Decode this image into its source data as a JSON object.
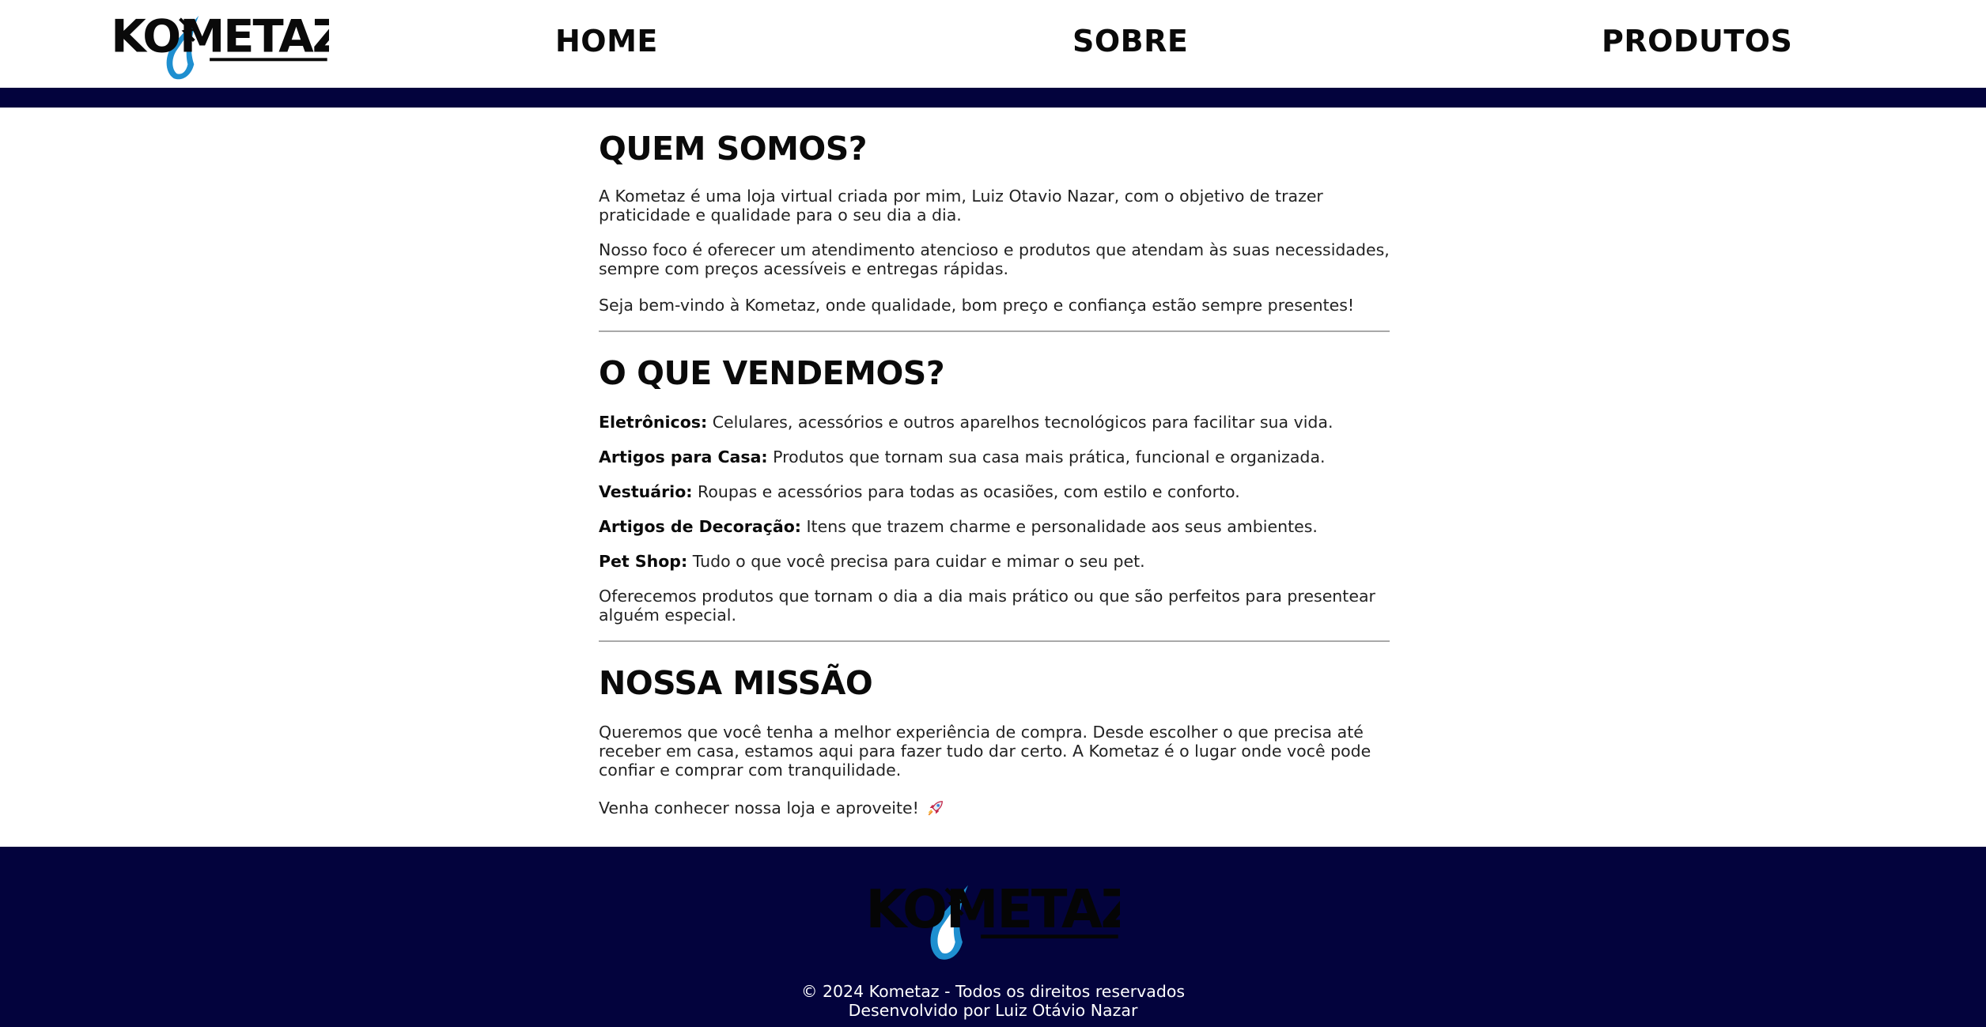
{
  "header": {
    "logo_text": "KOMETAZ",
    "nav": [
      {
        "label": "HOME"
      },
      {
        "label": "SOBRE"
      },
      {
        "label": "PRODUTOS"
      }
    ]
  },
  "about": {
    "title": "QUEM SOMOS?",
    "paragraphs": [
      "A Kometaz é uma loja virtual criada por mim, Luiz Otavio Nazar, com o objetivo de trazer praticidade e qualidade para o seu dia a dia.",
      "Nosso foco é oferecer um atendimento atencioso e produtos que atendam às suas necessidades, sempre com preços acessíveis e entregas rápidas.",
      "Seja bem-vindo à Kometaz, onde qualidade, bom preço e confiança estão sempre presentes!"
    ]
  },
  "sales": {
    "title": "O QUE VENDEMOS?",
    "items": [
      {
        "label": "Eletrônicos:",
        "text": " Celulares, acessórios e outros aparelhos tecnológicos para facilitar sua vida."
      },
      {
        "label": "Artigos para Casa:",
        "text": " Produtos que tornam sua casa mais prática, funcional e organizada."
      },
      {
        "label": "Vestuário:",
        "text": " Roupas e acessórios para todas as ocasiões, com estilo e conforto."
      },
      {
        "label": "Artigos de Decoração:",
        "text": " Itens que trazem charme e personalidade aos seus ambientes."
      },
      {
        "label": "Pet Shop:",
        "text": " Tudo o que você precisa para cuidar e mimar o seu pet."
      }
    ],
    "closing": "Oferecemos produtos que tornam o dia a dia mais prático ou que são perfeitos para presentear alguém especial."
  },
  "mission": {
    "title": "NOSSA MISSÃO",
    "paragraphs": [
      "Queremos que você tenha a melhor experiência de compra. Desde escolher o que precisa até receber em casa, estamos aqui para fazer tudo dar certo. A Kometaz é o lugar onde você pode confiar e comprar com tranquilidade.",
      "Venha conhecer nossa loja e aproveite!"
    ],
    "closing_icon": "rocket-icon"
  },
  "footer": {
    "logo_text": "KOMETAZ",
    "copyright": "© 2024 Kometaz - Todos os direitos reservados",
    "credit": "Desenvolvido por Luiz Otávio Nazar"
  },
  "colors": {
    "navy": "#03033d",
    "comet_blue": "#1e8fd0",
    "text": "#222222",
    "divider": "#a9a9a9"
  }
}
